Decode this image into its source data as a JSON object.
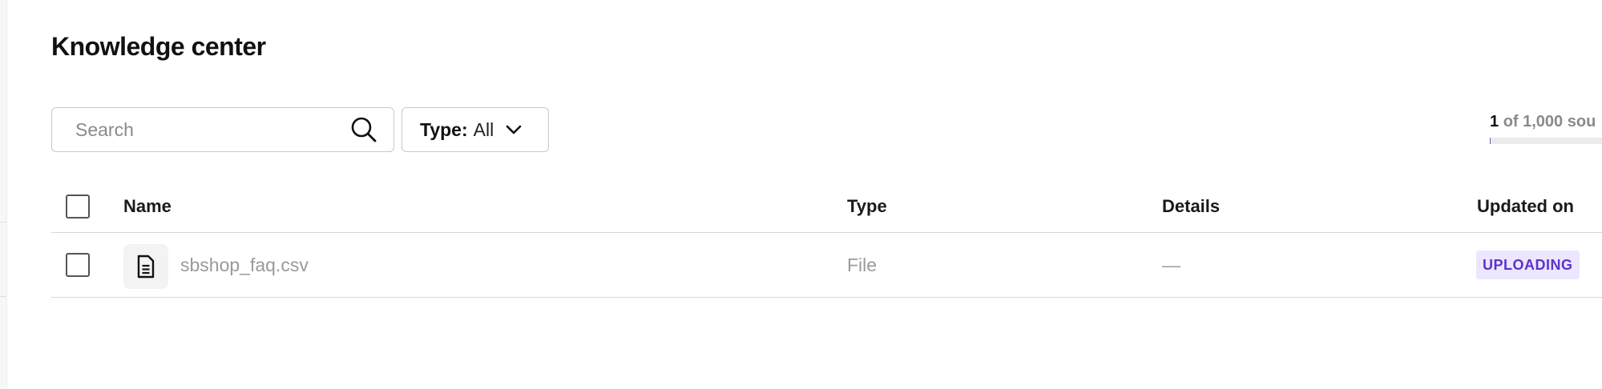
{
  "page": {
    "title": "Knowledge center"
  },
  "toolbar": {
    "search": {
      "placeholder": "Search",
      "value": ""
    },
    "type_filter": {
      "label": "Type:",
      "value": "All"
    }
  },
  "sources": {
    "count": "1",
    "rest": "of 1,000 sou",
    "usage_fraction": 0.001,
    "accent": "#6b5fd3"
  },
  "table": {
    "headers": {
      "name": "Name",
      "type": "Type",
      "details": "Details",
      "updated_on": "Updated on"
    },
    "rows": [
      {
        "name": "sbshop_faq.csv",
        "type": "File",
        "details": "—",
        "status": "UPLOADING",
        "icon": "document-icon"
      }
    ]
  },
  "colors": {
    "status_bg": "#ece6ff",
    "status_text": "#5a34c9"
  }
}
